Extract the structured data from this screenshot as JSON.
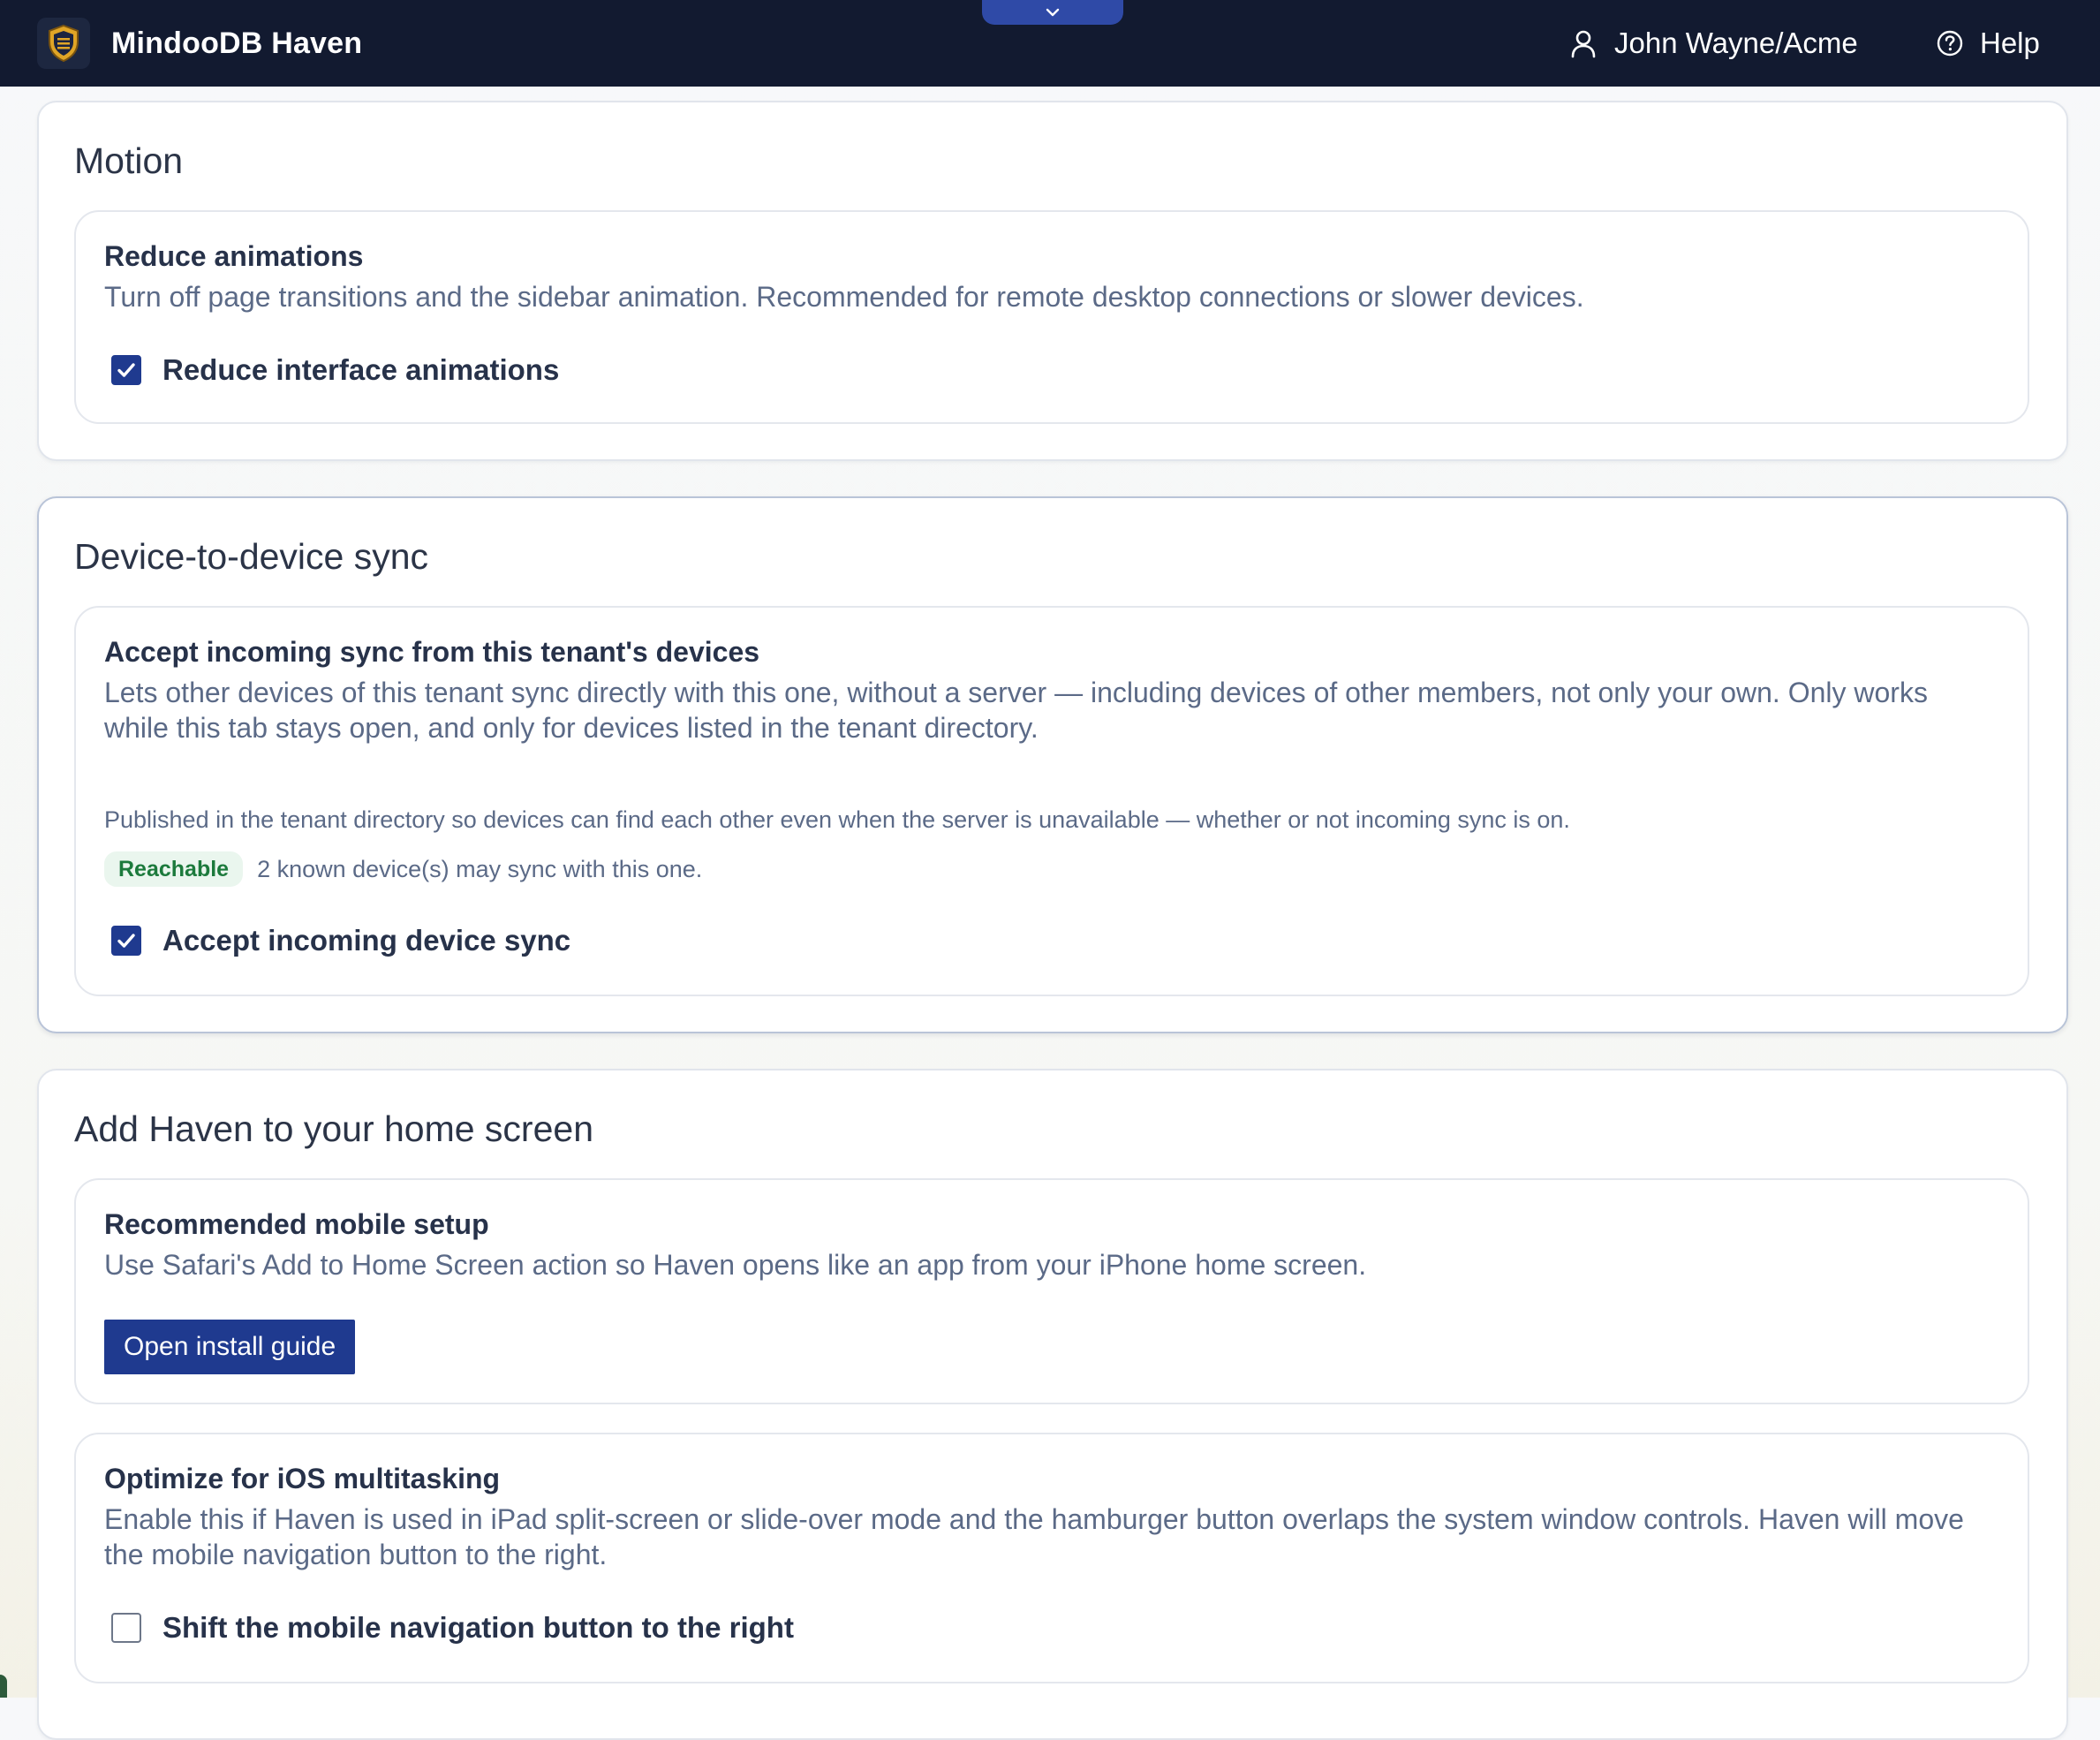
{
  "app": {
    "title": "MindooDB Haven",
    "logo_icon": "shield-crest-icon",
    "drawer_toggle_icon": "chevron-down-icon"
  },
  "header": {
    "user": {
      "icon": "user-icon",
      "label": "John Wayne/Acme"
    },
    "help": {
      "icon": "help-circle-icon",
      "label": "Help"
    }
  },
  "sections": {
    "motion": {
      "title": "Motion",
      "panel": {
        "heading": "Reduce animations",
        "description": "Turn off page transitions and the sidebar animation. Recommended for remote desktop connections or slower devices.",
        "checkbox": {
          "label": "Reduce interface animations",
          "checked": true
        }
      }
    },
    "sync": {
      "title": "Device-to-device sync",
      "panel": {
        "heading": "Accept incoming sync from this tenant's devices",
        "description": "Lets other devices of this tenant sync directly with this one, without a server — including devices of other members, not only your own. Only works while this tab stays open, and only for devices listed in the tenant directory.",
        "note": "Published in the tenant directory so devices can find each other even when the server is unavailable — whether or not incoming sync is on.",
        "status_badge": "Reachable",
        "status_text": "2 known device(s) may sync with this one.",
        "checkbox": {
          "label": "Accept incoming device sync",
          "checked": true
        }
      }
    },
    "home_screen": {
      "title": "Add Haven to your home screen",
      "mobile_panel": {
        "heading": "Recommended mobile setup",
        "description": "Use Safari's Add to Home Screen action so Haven opens like an app from your iPhone home screen.",
        "button_label": "Open install guide"
      },
      "ios_panel": {
        "heading": "Optimize for iOS multitasking",
        "description": "Enable this if Haven is used in iPad split-screen or slide-over mode and the hamburger button overlaps the system window controls. Haven will move the mobile navigation button to the right.",
        "checkbox": {
          "label": "Shift the mobile navigation button to the right",
          "checked": false
        }
      }
    }
  },
  "colors": {
    "topbar_background": "#121a30",
    "accent": "#1f3a8f",
    "status_green": "#1c7a3c",
    "muted_text": "#5b6a87"
  }
}
